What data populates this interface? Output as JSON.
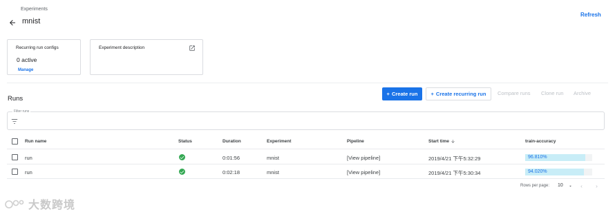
{
  "header": {
    "breadcrumb": "Experiments",
    "title": "mnist",
    "refresh_label": "Refresh"
  },
  "cards": {
    "recurring": {
      "title": "Recurring run configs",
      "value": "0 active",
      "link": "Manage"
    },
    "description": {
      "title": "Experiment description"
    }
  },
  "toolbar": {
    "section_label": "Runs",
    "create_run": "Create run",
    "create_recurring_run": "Create recurring run",
    "compare_runs": "Compare runs",
    "clone_run": "Clone run",
    "archive": "Archive"
  },
  "filter": {
    "label": "Filter runs"
  },
  "table": {
    "columns": [
      "Run name",
      "Status",
      "Duration",
      "Experiment",
      "Pipeline",
      "Start time",
      "train-accuracy"
    ],
    "rows": [
      {
        "name": "run",
        "status": "succeeded",
        "duration": "0:01:56",
        "experiment": "mnist",
        "pipeline": "[View pipeline]",
        "start_time": "2019/4/21 下午5:32:29",
        "accuracy_label": "96.810%",
        "accuracy": 0.9681
      },
      {
        "name": "run",
        "status": "succeeded",
        "duration": "0:02:18",
        "experiment": "mnist",
        "pipeline": "[View pipeline]",
        "start_time": "2019/4/21 下午5:30:34",
        "accuracy_label": "94.020%",
        "accuracy": 0.9402
      }
    ]
  },
  "pagination": {
    "rows_per_page_label": "Rows per page:",
    "rows_per_page": "10"
  },
  "colors": {
    "accent": "#1a73e8",
    "success": "#34a853",
    "bar": "#c8edf7"
  },
  "watermark": {
    "text": "大数跨境"
  }
}
